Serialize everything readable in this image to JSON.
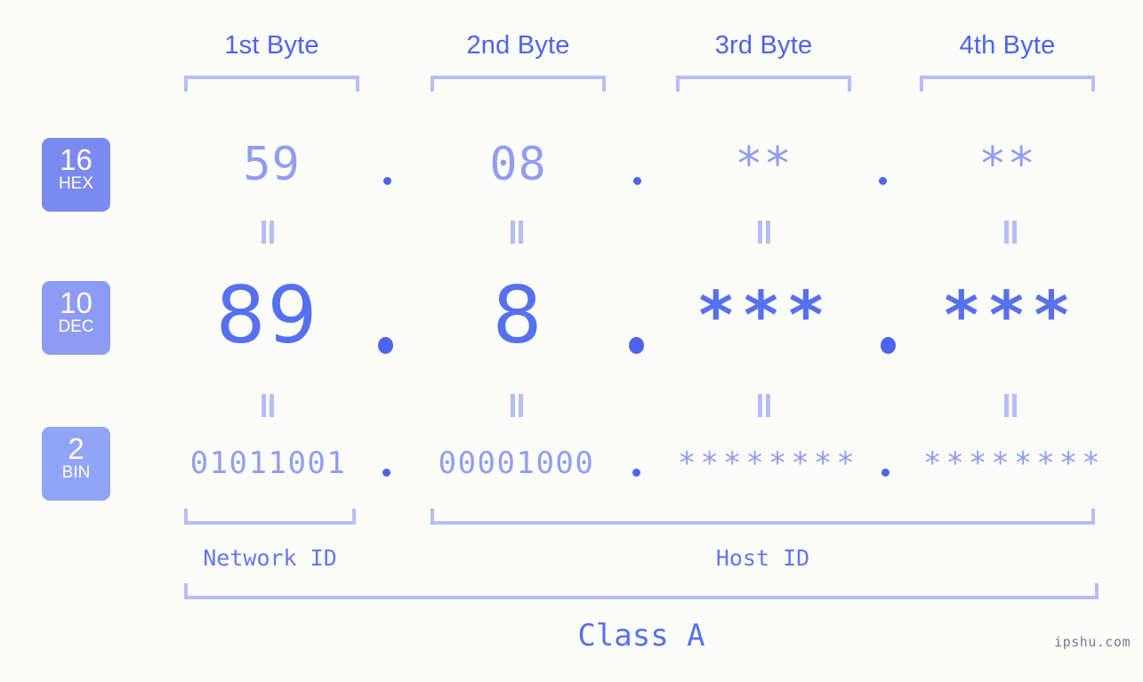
{
  "watermark": "ipshu.com",
  "byte_headers": [
    {
      "label": "1st Byte"
    },
    {
      "label": "2nd Byte"
    },
    {
      "label": "3rd Byte"
    },
    {
      "label": "4th Byte"
    }
  ],
  "bases": [
    {
      "num": "16",
      "name": "HEX",
      "color": "#7b8af0"
    },
    {
      "num": "10",
      "name": "DEC",
      "color": "#8e9bf4"
    },
    {
      "num": "2",
      "name": "BIN",
      "color": "#92a4f7"
    }
  ],
  "rows": {
    "hex": {
      "base": "16",
      "base_name": "HEX",
      "values": [
        "59",
        "08",
        "**",
        "**"
      ]
    },
    "dec": {
      "base": "10",
      "base_name": "DEC",
      "values": [
        "89",
        "8",
        "***",
        "***"
      ]
    },
    "bin": {
      "base": "2",
      "base_name": "BIN",
      "values": [
        "01011001",
        "00001000",
        "********",
        "********"
      ]
    }
  },
  "separator": ".",
  "equals_glyph": "=",
  "segments": [
    {
      "label": "Network ID"
    },
    {
      "label": "Host ID"
    }
  ],
  "class_label": "Class A",
  "colors": {
    "background": "#fcfdfa",
    "accent_strong": "#4d63f0",
    "accent_mid": "#5570f0",
    "accent_light": "#919df3",
    "bracket": "#b6bdfb",
    "watermark": "#7c7c7c"
  }
}
